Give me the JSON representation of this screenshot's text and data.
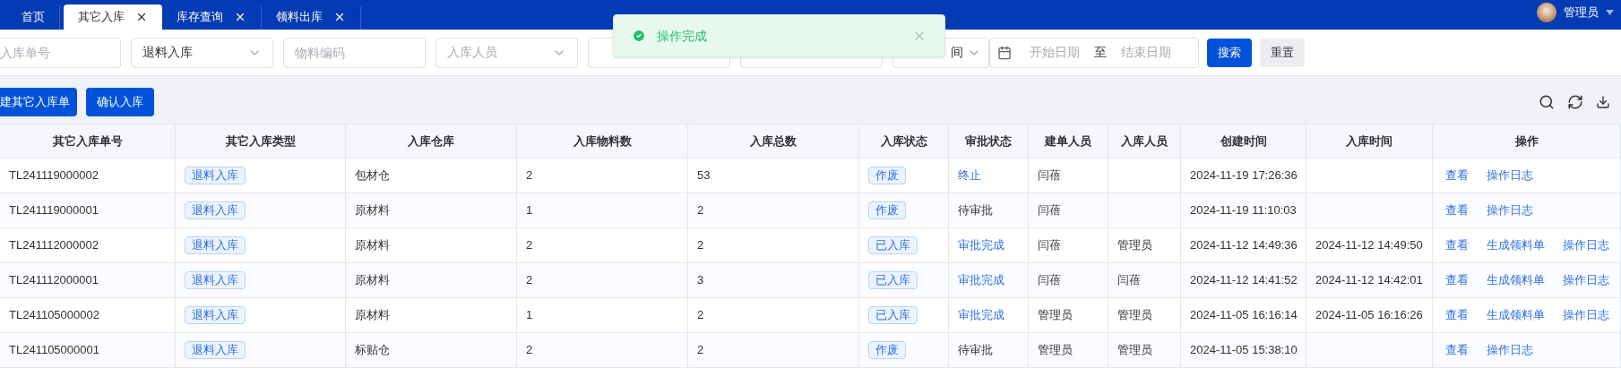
{
  "tabs": [
    {
      "label": "首页",
      "selected": false,
      "closable": false
    },
    {
      "label": "其它入库",
      "selected": true,
      "closable": true
    },
    {
      "label": "库存查询",
      "selected": false,
      "closable": true
    },
    {
      "label": "领料出库",
      "selected": false,
      "closable": true
    }
  ],
  "user": {
    "name": "管理员"
  },
  "toast": {
    "message": "操作完成"
  },
  "filters": [
    {
      "kind": "input",
      "placeholder": "入库单号"
    },
    {
      "kind": "select",
      "value": "退料入库"
    },
    {
      "kind": "input",
      "placeholder": "物料编码"
    },
    {
      "kind": "select",
      "placeholder": "入库人员"
    },
    {
      "kind": "input"
    },
    {
      "kind": "input"
    },
    {
      "kind": "select",
      "value": "间"
    },
    {
      "kind": "date",
      "start_placeholder": "开始日期",
      "separator": "至",
      "end_placeholder": "结束日期"
    }
  ],
  "filter_buttons": [
    {
      "label": "搜索",
      "kind": "primary"
    },
    {
      "label": "重置",
      "kind": "default"
    }
  ],
  "toolbar": {
    "buttons": [
      "建其它入库单",
      "确认入库"
    ]
  },
  "table": {
    "columns": [
      "其它入库单号",
      "其它入库类型",
      "入库仓库",
      "入库物料数",
      "入库总数",
      "入库状态",
      "审批状态",
      "建单人员",
      "入库人员",
      "创建时间",
      "入库时间",
      "操作"
    ],
    "rows": [
      {
        "number": "TL241119000002",
        "type": "退料入库",
        "warehouse": "包材仓",
        "items": "2",
        "total": "53",
        "status": "作废",
        "approval": {
          "text": "终止",
          "kind": "link"
        },
        "creator": "闫蓓",
        "receiver": "",
        "created": "2024-11-19 17:26:36",
        "received": "",
        "actions": [
          "查看",
          "操作日志"
        ]
      },
      {
        "number": "TL241119000001",
        "type": "退料入库",
        "warehouse": "原材料",
        "items": "1",
        "total": "2",
        "status": "作废",
        "approval": {
          "text": "待审批",
          "kind": "text"
        },
        "creator": "闫蓓",
        "receiver": "",
        "created": "2024-11-19 11:10:03",
        "received": "",
        "actions": [
          "查看",
          "操作日志"
        ]
      },
      {
        "number": "TL241112000002",
        "type": "退料入库",
        "warehouse": "原材料",
        "items": "2",
        "total": "2",
        "status": "已入库",
        "approval": {
          "text": "审批完成",
          "kind": "link"
        },
        "creator": "闫蓓",
        "receiver": "管理员",
        "created": "2024-11-12 14:49:36",
        "received": "2024-11-12 14:49:50",
        "actions": [
          "查看",
          "生成领料单",
          "操作日志"
        ]
      },
      {
        "number": "TL241112000001",
        "type": "退料入库",
        "warehouse": "原材料",
        "items": "2",
        "total": "3",
        "status": "已入库",
        "approval": {
          "text": "审批完成",
          "kind": "link"
        },
        "creator": "闫蓓",
        "receiver": "闫蓓",
        "created": "2024-11-12 14:41:52",
        "received": "2024-11-12 14:42:01",
        "actions": [
          "查看",
          "生成领料单",
          "操作日志"
        ]
      },
      {
        "number": "TL241105000002",
        "type": "退料入库",
        "warehouse": "原材料",
        "items": "1",
        "total": "2",
        "status": "已入库",
        "approval": {
          "text": "审批完成",
          "kind": "link"
        },
        "creator": "管理员",
        "receiver": "管理员",
        "created": "2024-11-05 16:16:14",
        "received": "2024-11-05 16:16:26",
        "actions": [
          "查看",
          "生成领料单",
          "操作日志"
        ]
      },
      {
        "number": "TL241105000001",
        "type": "退料入库",
        "warehouse": "标贴仓",
        "items": "2",
        "total": "2",
        "status": "作废",
        "approval": {
          "text": "待审批",
          "kind": "text"
        },
        "creator": "管理员",
        "receiver": "管理员",
        "created": "2024-11-05 15:38:10",
        "received": "",
        "actions": [
          "查看",
          "操作日志"
        ]
      }
    ]
  }
}
